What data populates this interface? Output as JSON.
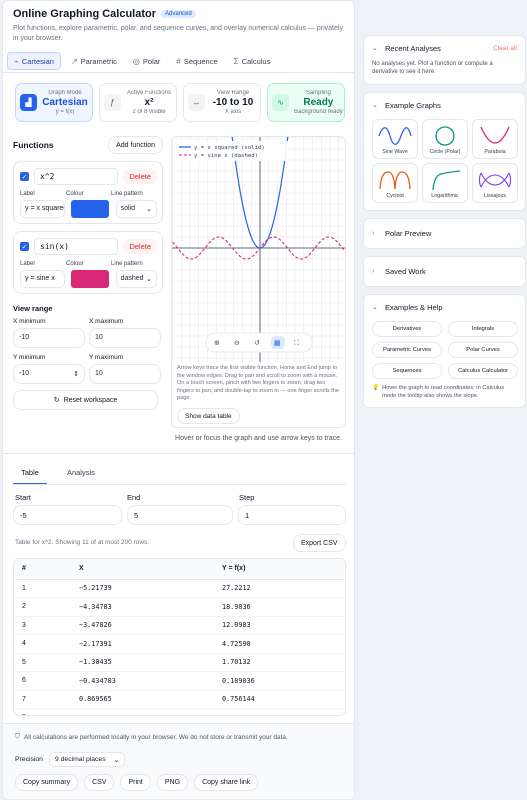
{
  "header": {
    "title": "Online Graphing Calculator",
    "badge": "Advanced",
    "subtitle": "Plot functions, explore parametric, polar, and sequence curves, and overlay numerical calculus — privately in your browser."
  },
  "tabs": [
    {
      "label": "Cartesian",
      "icon": "chart-icon",
      "active": true
    },
    {
      "label": "Parametric",
      "icon": "curve-icon"
    },
    {
      "label": "Polar",
      "icon": "polar-icon"
    },
    {
      "label": "Sequence",
      "icon": "hash-icon"
    },
    {
      "label": "Calculus",
      "icon": "sigma-icon"
    }
  ],
  "cards": [
    {
      "label": "Graph Mode",
      "value": "Cartesian",
      "sub": "y = f(x)"
    },
    {
      "label": "Active Functions",
      "value": "x²",
      "sub": "2 of 8 visible"
    },
    {
      "label": "View Range",
      "value": "-10 to 10",
      "sub": "X axis"
    },
    {
      "label": "Sampling",
      "value": "Ready",
      "sub": "Background ready"
    }
  ],
  "functions": {
    "heading": "Functions",
    "add_label": "Add function",
    "delete_label": "Delete",
    "label_hdr": "Label",
    "colour_hdr": "Colour",
    "pattern_hdr": "Line pattern",
    "items": [
      {
        "expr": "x^2",
        "label": "y = x squared",
        "color": "#2563eb",
        "pattern": "solid"
      },
      {
        "expr": "sin(x)",
        "label": "y = sine x",
        "color": "#db2777",
        "pattern": "dashed"
      }
    ]
  },
  "view_range": {
    "heading": "View range",
    "xmin_label": "X minimum",
    "xmin": "-10",
    "xmax_label": "X maximum",
    "xmax": "10",
    "ymin_label": "Y minimum",
    "ymin": "-10",
    "ymax_label": "Y maximum",
    "ymax": "10",
    "reset_label": "Reset workspace"
  },
  "graph": {
    "legend": [
      "y = x squared (solid)",
      "y = sine x (dashed)"
    ],
    "note": "Arrow keys trace the first visible function. Home and End jump to the window edges. Drag to pan and scroll to zoom with a mouse. On a touch screen, pinch with two fingers to zoom, drag two fingers to pan, and double-tap to zoom in — one finger scrolls the page.",
    "show_data": "Show data table",
    "hover": "Hover or focus the graph and use arrow keys to trace."
  },
  "table": {
    "tabs": [
      "Table",
      "Analysis"
    ],
    "start_label": "Start",
    "start": "-5",
    "end_label": "End",
    "end": "5",
    "step_label": "Step",
    "step": "1",
    "info": "Table for x^2. Showing 11 of at most 200 rows.",
    "export": "Export CSV",
    "headers": [
      "#",
      "X",
      "Y = f(x)"
    ],
    "rows": [
      [
        "1",
        "−5.21739",
        "27.2212"
      ],
      [
        "2",
        "−4.34783",
        "18.9036"
      ],
      [
        "3",
        "−3.47826",
        "12.0983"
      ],
      [
        "4",
        "−2.17391",
        "4.72590"
      ],
      [
        "5",
        "−1.30435",
        "1.70132"
      ],
      [
        "6",
        "−0.434783",
        "0.189036"
      ],
      [
        "7",
        "0.869565",
        "0.756144"
      ],
      [
        "8",
        "1.73913",
        "3.02457"
      ]
    ]
  },
  "footer": {
    "privacy": "All calculations are performed locally in your browser. We do not store or transmit your data.",
    "precision_label": "Precision",
    "precision_value": "9 decimal places",
    "buttons": [
      "Copy summary",
      "CSV",
      "Print",
      "PNG",
      "Copy share link"
    ]
  },
  "sidebar": {
    "recent": {
      "title": "Recent Analyses",
      "clear": "Clear all",
      "empty": "No analyses yet. Plot a function or compute a derivative to see it here."
    },
    "examples": {
      "title": "Example Graphs",
      "items": [
        "Sine Wave",
        "Circle (Polar)",
        "Parabola",
        "Cycloid",
        "Logarithmic",
        "Lissajous"
      ]
    },
    "polar": {
      "title": "Polar Preview"
    },
    "saved": {
      "title": "Saved Work"
    },
    "help": {
      "title": "Examples & Help",
      "pills": [
        "Derivatives",
        "Integrals",
        "Parametric Curves",
        "Polar Curves",
        "Sequences",
        "Calculus Calculator"
      ],
      "hint": "Hover the graph to read coordinates; in Calculus mode the tooltip also shows the slope."
    }
  },
  "colors": {
    "accent": "#2563eb",
    "pink": "#db2777",
    "danger": "#dc2626",
    "success": "#059669"
  }
}
